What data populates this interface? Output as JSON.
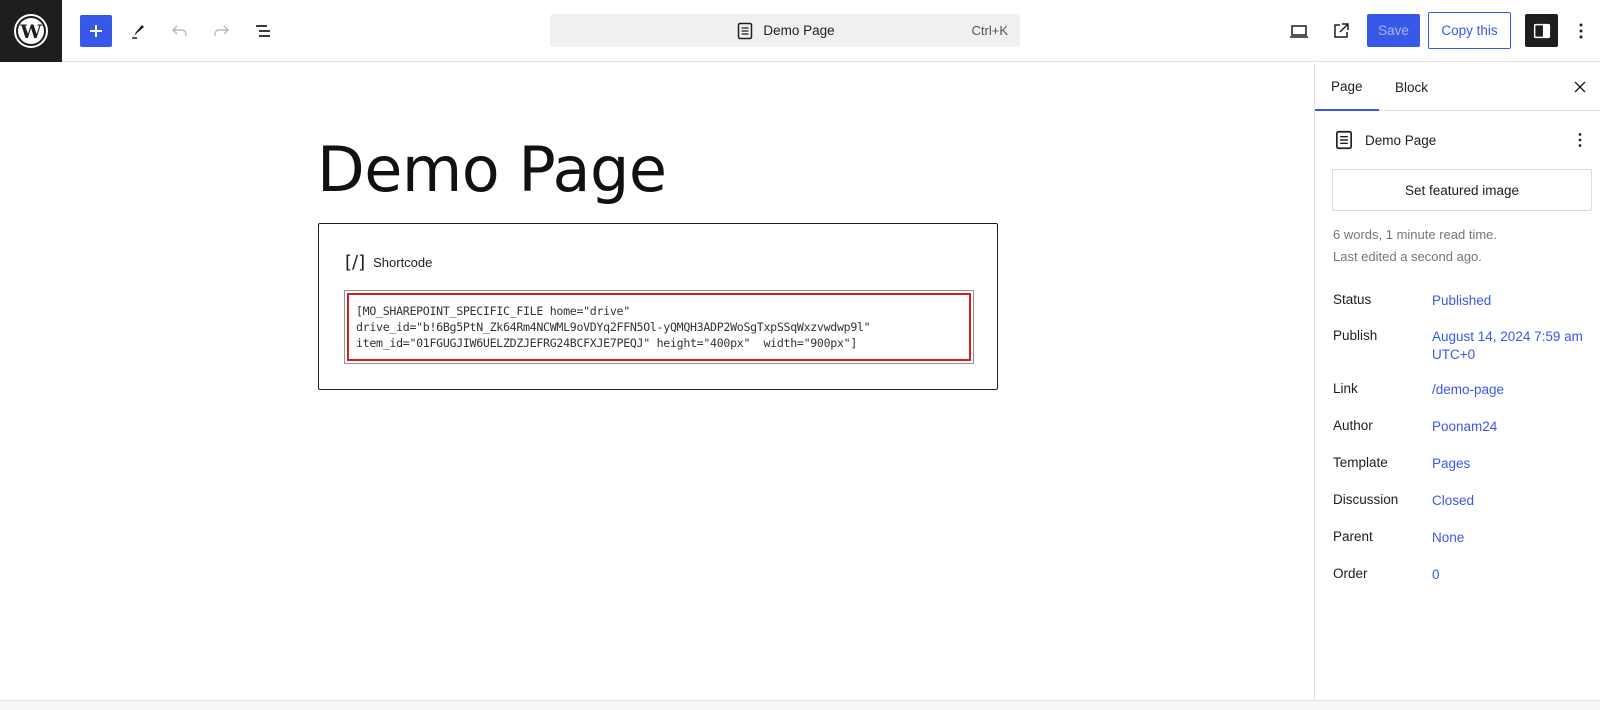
{
  "toolbar": {
    "command_bar_title": "Demo Page",
    "command_bar_shortcut": "Ctrl+K",
    "save_label": "Save",
    "copy_label": "Copy this",
    "icons": [
      "wordpress-logo",
      "plus-icon",
      "pencil-icon",
      "undo-icon",
      "redo-icon",
      "list-view-icon",
      "desktop-preview-icon",
      "external-view-icon",
      "settings-panel-icon",
      "kebab-menu-icon"
    ]
  },
  "editor": {
    "title": "Demo Page",
    "block": {
      "label_icon": "[/]",
      "label": "Shortcode",
      "content": "[MO_SHAREPOINT_SPECIFIC_FILE home=\"drive\"\ndrive_id=\"b!6Bg5PtN_Zk64Rm4NCWML9oVDYq2FFN5Ol-yQMQH3ADP2WoSgTxpSSqWxzvwdwp9l\"\nitem_id=\"01FGUGJIW6UELZDZJEFRG24BCFXJE7PEQJ\" height=\"400px\"  width=\"900px\"]"
    }
  },
  "sidebar": {
    "tabs": [
      {
        "label": "Page",
        "active": true
      },
      {
        "label": "Block",
        "active": false
      }
    ],
    "doc_title": "Demo Page",
    "featured_image_label": "Set featured image",
    "word_count": "6 words, 1 minute read time.",
    "last_edited": "Last edited a second ago.",
    "properties": [
      {
        "key": "Status",
        "value": "Published"
      },
      {
        "key": "Publish",
        "value": "August 14, 2024 7:59 am UTC+0"
      },
      {
        "key": "Link",
        "value": "/demo-page"
      },
      {
        "key": "Author",
        "value": "Poonam24"
      },
      {
        "key": "Template",
        "value": "Pages"
      },
      {
        "key": "Discussion",
        "value": "Closed"
      },
      {
        "key": "Parent",
        "value": "None"
      },
      {
        "key": "Order",
        "value": "0"
      }
    ]
  },
  "colors": {
    "accent": "#3858e9",
    "dark": "#1e1e1e",
    "highlight_border": "#d21f1f"
  }
}
